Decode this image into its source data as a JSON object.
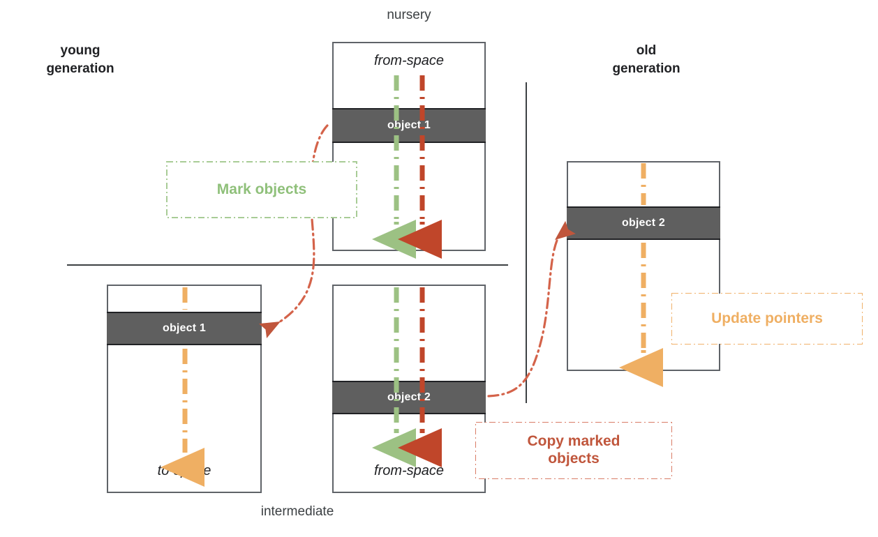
{
  "diagram": {
    "title_labels": {
      "nursery": "nursery",
      "intermediate": "intermediate",
      "young_generation": "young\ngeneration",
      "young_generation_line1": "young",
      "young_generation_line2": "generation",
      "old_generation_line1": "old",
      "old_generation_line2": "generation"
    },
    "regions": [
      {
        "id": "nursery-from-space",
        "space_label": "from-space",
        "space_label_position": "top",
        "object_label": "object 1",
        "arrows": [
          "mark-green",
          "copy-red"
        ]
      },
      {
        "id": "intermediate-to-space",
        "space_label": "to-space",
        "space_label_position": "bottom",
        "object_label": "object 1",
        "arrows": [
          "update-orange"
        ]
      },
      {
        "id": "intermediate-from-space",
        "space_label": "from-space",
        "space_label_position": "bottom",
        "object_label": "object 2",
        "arrows": [
          "mark-green",
          "copy-red"
        ]
      },
      {
        "id": "old-generation",
        "space_label": "",
        "space_label_position": "none",
        "object_label": "object 2",
        "arrows": [
          "update-orange"
        ]
      }
    ],
    "callouts": [
      {
        "id": "mark-objects",
        "text": "Mark objects",
        "color": "#8fc07a"
      },
      {
        "id": "copy-marked-objects",
        "text_line1": "Copy marked",
        "text_line2": "objects",
        "color": "#c0563c"
      },
      {
        "id": "update-pointers",
        "text": "Update pointers",
        "color": "#efaf63"
      }
    ],
    "colors": {
      "green": "#8fc07a",
      "green_border": "#a8cc96",
      "red": "#c0563c",
      "red_light": "#d97c66",
      "orange": "#efaf63",
      "object_fill": "#5f5f5f",
      "region_border": "#5f6368",
      "text": "#202124"
    }
  }
}
